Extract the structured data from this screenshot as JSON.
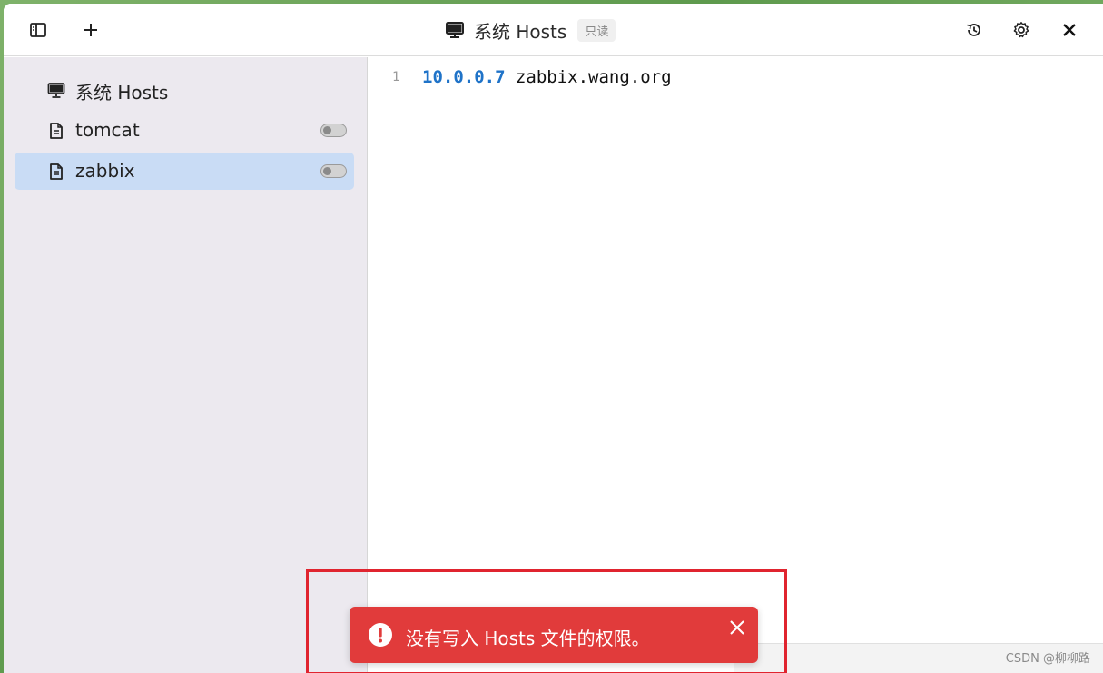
{
  "window": {
    "title": "系统 Hosts",
    "readonly_badge": "只读"
  },
  "toolbar": {
    "icons": [
      "sidebar-toggle-icon",
      "plus-icon",
      "history-icon",
      "gear-icon",
      "close-icon"
    ]
  },
  "sidebar": {
    "items": [
      {
        "label": "系统 Hosts",
        "icon": "monitor-icon",
        "has_toggle": false,
        "active": false
      },
      {
        "label": "tomcat",
        "icon": "file-icon",
        "has_toggle": true,
        "enabled": false,
        "active": false
      },
      {
        "label": "zabbix",
        "icon": "file-icon",
        "has_toggle": true,
        "enabled": false,
        "active": true
      }
    ]
  },
  "editor": {
    "line_number": "1",
    "ip": "10.0.0.7",
    "host": " zabbix.wang.org"
  },
  "toast": {
    "message": "没有写入 Hosts 文件的权限。",
    "color": "#e13b3b"
  },
  "watermark": "CSDN @柳柳路",
  "colors": {
    "accent": "#1f73c8",
    "active_item": "#c9dcf5",
    "sidebar_bg": "#ece9ef",
    "annotation_box": "#e0242f"
  }
}
